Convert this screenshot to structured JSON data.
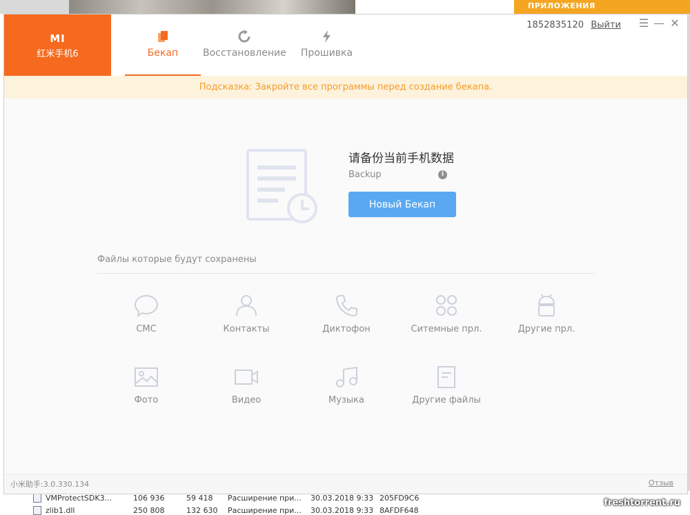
{
  "background": {
    "banner_text": "ПРИЛОЖЕНИЯ",
    "files": [
      {
        "name": "VMProtectSDK3...",
        "size": "106 936",
        "packed": "59 418",
        "type": "Расширение при...",
        "date": "30.03.2018 9:33",
        "crc": "205FD9C6"
      },
      {
        "name": "zlib1.dll",
        "size": "250 808",
        "packed": "132 630",
        "type": "Расширение при...",
        "date": "30.03.2018 9:33",
        "crc": "8AFDF648"
      }
    ],
    "watermark": "freshtorrent.ru"
  },
  "app": {
    "brand": {
      "logo": "MI",
      "model": "红米手机6"
    },
    "tabs": [
      {
        "label": "Бекап",
        "icon": "backup-icon",
        "active": true
      },
      {
        "label": "Восстановление",
        "icon": "restore-icon",
        "active": false
      },
      {
        "label": "Прошивка",
        "icon": "flash-icon",
        "active": false
      }
    ],
    "account": {
      "id": "1852835120",
      "logout_label": "Выйти"
    },
    "window_controls": {
      "menu": "☰",
      "minimize": "—",
      "close": "✕"
    },
    "hint": "Подсказка: Закройте все программы перед создание бекапа.",
    "hero": {
      "title": "请备份当前手机数据",
      "subtitle": "Backup",
      "info_icon": "i",
      "button_label": "Новый Бекап"
    },
    "section_label": "Файлы которые будут сохранены",
    "categories": [
      {
        "label": "СМС",
        "icon": "sms-icon"
      },
      {
        "label": "Контакты",
        "icon": "contacts-icon"
      },
      {
        "label": "Диктофон",
        "icon": "phone-icon"
      },
      {
        "label": "Ситемные прл.",
        "icon": "apps-icon"
      },
      {
        "label": "Другие прл.",
        "icon": "android-icon"
      },
      {
        "label": "Фото",
        "icon": "photo-icon"
      },
      {
        "label": "Видео",
        "icon": "video-icon"
      },
      {
        "label": "Музыка",
        "icon": "music-icon"
      },
      {
        "label": "Другие файлы",
        "icon": "file-icon"
      }
    ],
    "footer": {
      "version": "小米助手:3.0.330.134",
      "feedback_label": "Отзыв"
    },
    "colors": {
      "brand": "#f56a1e",
      "primary": "#5aa9f0",
      "hint_text": "#f39c2a",
      "hint_bg": "#fdf2dc"
    }
  }
}
